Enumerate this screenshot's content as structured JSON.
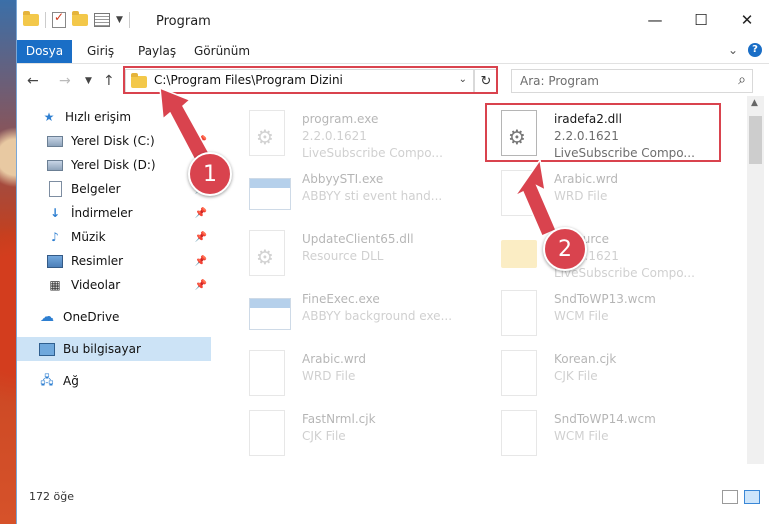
{
  "window": {
    "title": "Program"
  },
  "ribbon": {
    "tabs": [
      "Dosya",
      "Giriş",
      "Paylaş",
      "Görünüm"
    ]
  },
  "address": {
    "path": "C:\\Program Files\\Program Dizini"
  },
  "search": {
    "placeholder": "Ara: Program"
  },
  "sidebar": {
    "items": [
      {
        "label": "Hızlı erişim",
        "icon": "star-icon"
      },
      {
        "label": "Yerel Disk (C:)",
        "icon": "drive-icon",
        "pinned": true
      },
      {
        "label": "Yerel Disk (D:)",
        "icon": "drive-icon",
        "pinned": true
      },
      {
        "label": "Belgeler",
        "icon": "document-icon",
        "pinned": true
      },
      {
        "label": "İndirmeler",
        "icon": "download-icon",
        "pinned": true
      },
      {
        "label": "Müzik",
        "icon": "music-icon",
        "pinned": true
      },
      {
        "label": "Resimler",
        "icon": "pictures-icon",
        "pinned": true
      },
      {
        "label": "Videolar",
        "icon": "video-icon",
        "pinned": true
      },
      {
        "label": "OneDrive",
        "icon": "cloud-icon"
      },
      {
        "label": "Bu bilgisayar",
        "icon": "computer-icon",
        "selected": true
      },
      {
        "label": "Ağ",
        "icon": "network-icon"
      }
    ]
  },
  "files": [
    {
      "name": "program.exe",
      "line2": "2.2.0.1621",
      "line3": "LiveSubscribe Compo...",
      "type": "exe",
      "faded": true
    },
    {
      "name": "iradefa2.dll",
      "line2": "2.2.0.1621",
      "line3": "LiveSubscribe Compo...",
      "type": "dll",
      "faded": false
    },
    {
      "name": "AbbyySTI.exe",
      "line2": "ABBYY sti event hand...",
      "line3": "",
      "type": "exe",
      "faded": true
    },
    {
      "name": "Arabic.wrd",
      "line2": "WRD File",
      "line3": "",
      "type": "page",
      "faded": true
    },
    {
      "name": "UpdateClient65.dll",
      "line2": "Resource DLL",
      "line3": "",
      "type": "dll",
      "faded": true
    },
    {
      "name": "Resource",
      "line2": "2.2.0.1621",
      "line3": "LiveSubscribe Compo...",
      "type": "folder",
      "faded": true
    },
    {
      "name": "FineExec.exe",
      "line2": "ABBYY background exe...",
      "line3": "",
      "type": "exe",
      "faded": true
    },
    {
      "name": "SndToWP13.wcm",
      "line2": "WCM File",
      "line3": "",
      "type": "page",
      "faded": true
    },
    {
      "name": "Arabic.wrd",
      "line2": "WRD File",
      "line3": "",
      "type": "page",
      "faded": true
    },
    {
      "name": "Korean.cjk",
      "line2": "CJK File",
      "line3": "",
      "type": "page",
      "faded": true
    },
    {
      "name": "FastNrml.cjk",
      "line2": "CJK File",
      "line3": "",
      "type": "page",
      "faded": true
    },
    {
      "name": "SndToWP14.wcm",
      "line2": "WCM File",
      "line3": "",
      "type": "page",
      "faded": true
    }
  ],
  "status": {
    "count": "172 öğe"
  },
  "callouts": {
    "one": "1",
    "two": "2"
  },
  "colors": {
    "accent": "#1a6ec6",
    "highlight": "#d9434e",
    "selection": "#cce3f6"
  }
}
